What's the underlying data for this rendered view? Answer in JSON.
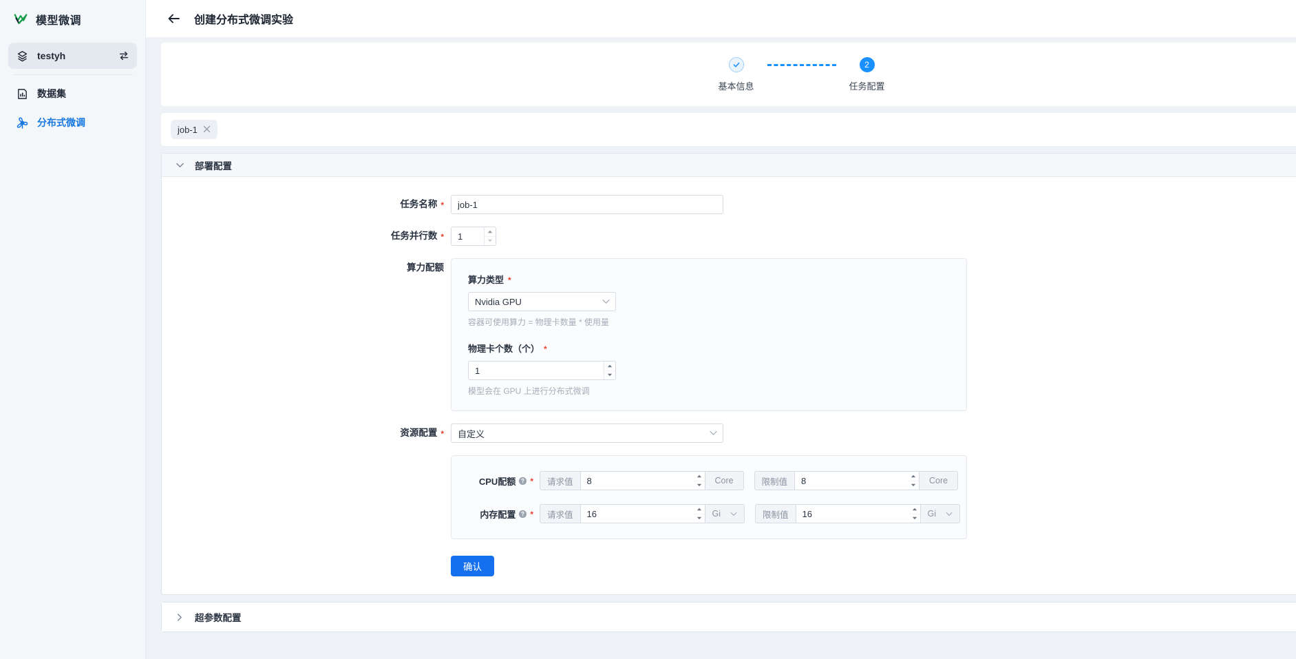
{
  "sidebar": {
    "brand": {
      "label": "模型微调",
      "icon": "logo-icon"
    },
    "project": {
      "label": "testyh",
      "icon": "project-icon",
      "action_icon": "swap-icon"
    },
    "items": [
      {
        "label": "数据集",
        "icon": "dataset-icon",
        "active": false
      },
      {
        "label": "分布式微调",
        "icon": "distributed-tuning-icon",
        "active": true
      }
    ]
  },
  "header": {
    "back_icon": "arrow-left-icon",
    "title": "创建分布式微调实验"
  },
  "stepper": {
    "steps": [
      {
        "label": "基本信息",
        "marker": "✓",
        "state": "done"
      },
      {
        "label": "任务配置",
        "marker": "2",
        "state": "current"
      }
    ]
  },
  "tabs": {
    "jobs": [
      {
        "label": "job-1",
        "close_icon": "close-icon"
      }
    ],
    "add_icon": "plus-icon",
    "add_label": "+"
  },
  "deploy_panel": {
    "title": "部署配置",
    "caret_icon": "chevron-down-icon",
    "fields": {
      "job_name": {
        "label": "任务名称",
        "required": true,
        "value": "job-1",
        "placeholder": ""
      },
      "parallelism": {
        "label": "任务并行数",
        "required": true,
        "value": "1",
        "placeholder": ""
      },
      "compute_quota": {
        "label": "算力配额",
        "compute_type": {
          "label": "算力类型",
          "required": true,
          "value": "Nvidia GPU",
          "caret_icon": "chevron-down-icon",
          "hint": "容器可使用算力 = 物理卡数量 * 使用量"
        },
        "card_count": {
          "label": "物理卡个数（个）",
          "required": true,
          "value": "1",
          "hint": "模型会在 GPU 上进行分布式微调"
        }
      },
      "resource_config": {
        "label": "资源配置",
        "required": true,
        "value": "自定义",
        "caret_icon": "chevron-down-icon"
      }
    },
    "resource_rows": [
      {
        "label": "CPU配额",
        "required": true,
        "help_icon": "question-circle-icon",
        "request": {
          "addon": "请求值",
          "value": "8",
          "placeholder": "请求值",
          "unit": "Core",
          "unit_select": false
        },
        "limit": {
          "addon": "限制值",
          "value": "8",
          "placeholder": "限制值",
          "unit": "Core",
          "unit_select": false
        }
      },
      {
        "label": "内存配置",
        "required": true,
        "help_icon": "question-circle-icon",
        "request": {
          "addon": "请求值",
          "value": "16",
          "placeholder": "请求值",
          "unit": "Gi",
          "unit_select": true
        },
        "limit": {
          "addon": "限制值",
          "value": "16",
          "placeholder": "限制值",
          "unit": "Gi",
          "unit_select": true
        }
      }
    ],
    "confirm_label": "确认"
  },
  "hyper_panel": {
    "title": "超参数配置",
    "caret_icon": "chevron-right-icon"
  },
  "colors": {
    "accent": "#1677e0",
    "primary_button": "#1570ef",
    "step_current": "#1890ff",
    "required_star": "#e8412f",
    "sidebar_bg": "#f4f7fa",
    "canvas_bg": "#eef1f5"
  }
}
